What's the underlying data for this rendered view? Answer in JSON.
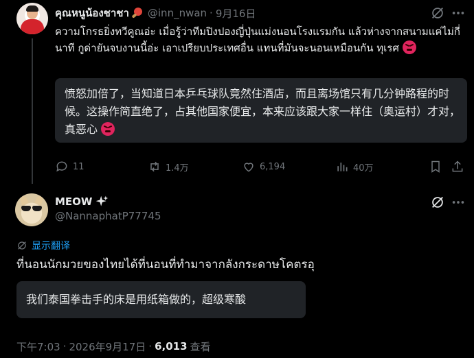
{
  "tweet1": {
    "display_name": "คุณหนูน้องชาชา",
    "handle": "@inn_nwan",
    "separator": "·",
    "date": "9月16日",
    "text": "ความโกรธยิ่งทวีคูณอ่ะ เมื่อรู้ว่าทีมปิงปองญี่ปุ่นแม่งนอนโรงแรมกัน แล้วห่างจากสนามแค่ไม่กี่นาที กูด่ายันจบงานนี้อ่ะ เอาเปรียบประเทศอื่น แทนที่มันจะนอนเหมือนกัน ทุเรศ",
    "translation": "愤怒加倍了，当知道日本乒乓球队竟然住酒店，而且离场馆只有几分钟路程的时候。这操作简直绝了，占其他国家便宜，本来应该跟大家一样住（奥运村）才对，真恶心",
    "replies": "11",
    "reposts": "1.4万",
    "likes": "6,194",
    "views": "40万",
    "icons": [
      "grok-icon",
      "more-icon",
      "reply-icon",
      "repost-icon",
      "like-icon",
      "views-icon",
      "bookmark-icon"
    ]
  },
  "tweet2": {
    "display_name": "MEOW",
    "handle": "@NannaphatP77745",
    "show_translation": "显示翻译",
    "text": "ที่นอนนักมวยของไทยได้ที่นอนที่ทำมาจากลังกระดาษโคตรอุ",
    "translation": "我们泰国拳击手的床是用纸箱做的，超级寒酸",
    "time": "下午7:03",
    "separator": "·",
    "date": "2026年9月17日",
    "views": "6,013",
    "views_label": "查看"
  },
  "colors": {
    "background": "#000000",
    "text": "#e7e9ea",
    "muted": "#71767b",
    "link": "#1d9bf0",
    "translation_box": "#202327"
  }
}
